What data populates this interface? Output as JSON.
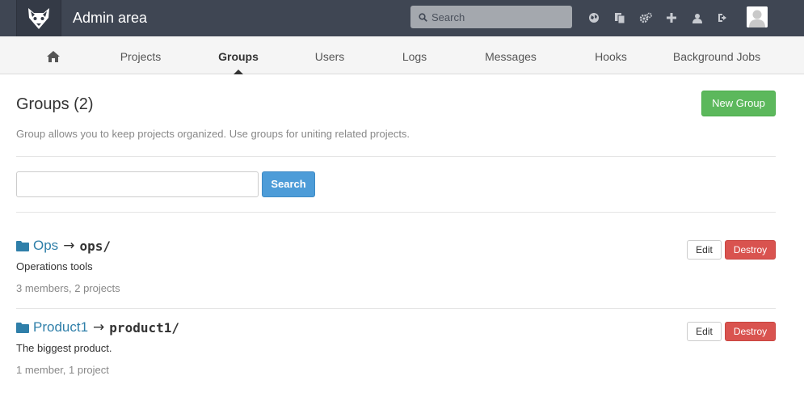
{
  "header": {
    "title": "Admin area",
    "search_placeholder": "Search",
    "icons": [
      "globe-icon",
      "copy-icon",
      "cogs-icon",
      "plus-icon",
      "user-icon",
      "sign-out-icon"
    ]
  },
  "nav": {
    "items": [
      {
        "label": "",
        "icon": "home-icon"
      },
      {
        "label": "Projects"
      },
      {
        "label": "Groups",
        "active": true
      },
      {
        "label": "Users"
      },
      {
        "label": "Logs"
      },
      {
        "label": "Messages"
      },
      {
        "label": "Hooks"
      },
      {
        "label": "Background Jobs"
      }
    ]
  },
  "main": {
    "title": "Groups (2)",
    "new_button": "New Group",
    "description": "Group allows you to keep projects organized. Use groups for uniting related projects.",
    "search_button": "Search",
    "search_value": ""
  },
  "groups": [
    {
      "name": "Ops",
      "path": "ops/",
      "description": "Operations tools",
      "meta": "3 members, 2 projects",
      "edit_label": "Edit",
      "destroy_label": "Destroy"
    },
    {
      "name": "Product1",
      "path": "product1/",
      "description": "The biggest product.",
      "meta": "1 member, 1 project",
      "edit_label": "Edit",
      "destroy_label": "Destroy"
    }
  ],
  "colors": {
    "header_bg": "#3f4653",
    "link": "#2f7fa9",
    "success": "#5cb85c",
    "danger": "#d9534f",
    "primary": "#4d9cd8"
  }
}
